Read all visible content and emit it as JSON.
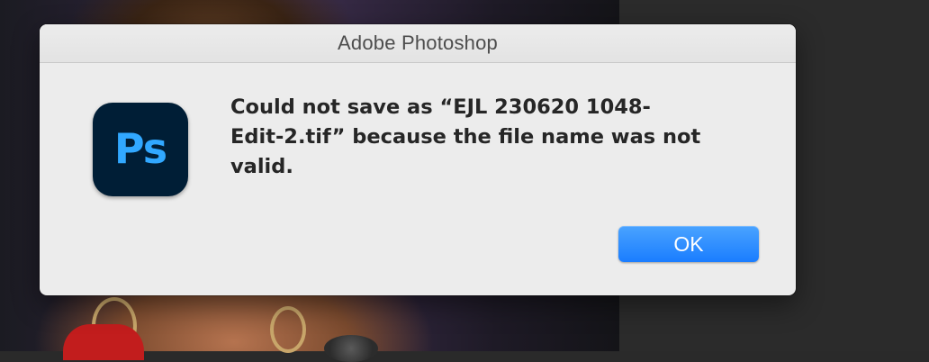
{
  "dialog": {
    "title": "Adobe Photoshop",
    "app_icon": {
      "name": "photoshop-app-icon",
      "label": "Ps",
      "background_color": "#001e36",
      "text_color": "#31a8ff"
    },
    "message_lines": [
      "Could not save as “EJL 230620 1048-",
      "Edit-2.tif” because the file name was not",
      "valid."
    ],
    "ok_label": "OK",
    "accent_color": "#1a7dff"
  }
}
